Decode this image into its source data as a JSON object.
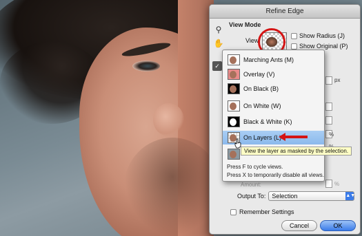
{
  "dialog": {
    "title": "Refine Edge",
    "view_mode_label": "View Mode",
    "view_label": "View:",
    "show_radius": "Show Radius (J)",
    "show_original": "Show Original (P)",
    "px_unit": "px",
    "percent_unit": "%",
    "amount_label": "Amount:",
    "output_to_label": "Output To:",
    "output_to_value": "Selection",
    "remember_settings": "Remember Settings",
    "cancel": "Cancel",
    "ok": "OK"
  },
  "menu": {
    "items": [
      {
        "label": "Marching Ants (M)",
        "thumb": "ants"
      },
      {
        "label": "Overlay (V)",
        "thumb": "overlay"
      },
      {
        "label": "On Black (B)",
        "thumb": "black"
      },
      {
        "label": "On White (W)",
        "thumb": "white"
      },
      {
        "label": "Black & White (K)",
        "thumb": "bw"
      },
      {
        "label": "On Layers (L)",
        "thumb": "layers"
      }
    ],
    "selected_index": 5,
    "hint_cycle": "Press F to cycle views.",
    "hint_disable": "Press X to temporarily disable all views."
  },
  "tooltip": "View the layer as masked by the selection.",
  "colors": {
    "accent": "#3b7be8",
    "annotation_red": "#d41414",
    "selection_blue": "#a9cef4",
    "tooltip_bg": "#ffffc6"
  },
  "icons": [
    "zoom-icon",
    "hand-icon",
    "refine-radius-icon",
    "checkbox-icon",
    "dropdown-arrow-icon"
  ]
}
